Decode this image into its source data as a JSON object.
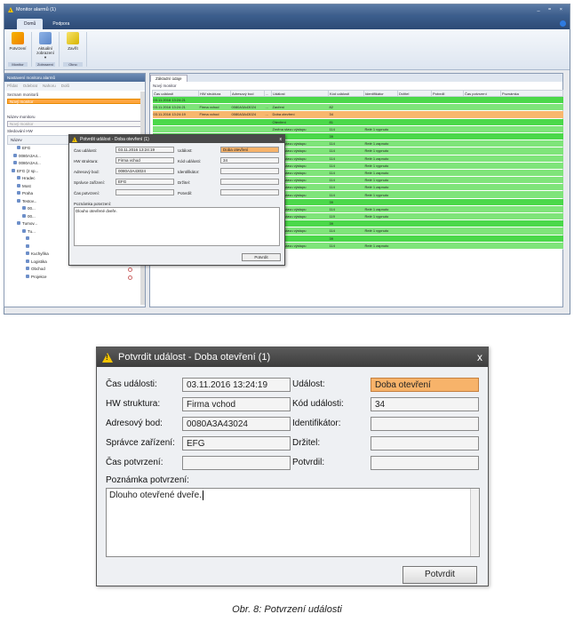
{
  "window": {
    "title": "Monitor alarmů (1)",
    "controls": "_ = ×"
  },
  "ribbon_tabs": [
    "Domů",
    "Podpora"
  ],
  "ribbon": {
    "btn_confirm": "Potvrzení",
    "btn_current": "Aktuální zobrazení ▾",
    "btn_close": "Zavřít",
    "grp1": "Monitor",
    "grp2": "Zobrazení",
    "grp3": "Okno"
  },
  "left_panel": {
    "title": "Nastavení monitoru alarmů",
    "toolbar": [
      "Přidat",
      "Odebrat",
      "Nahoru",
      "Dolů"
    ],
    "list_label": "Seznam monitorů",
    "selected_monitor": "Nový monitor",
    "name_label": "Název monitoru",
    "name_placeholder": "Nový monitor",
    "tracked_label": "Sledování HW",
    "tree_header": "Název",
    "tree": [
      "EFG",
      "0080A3A4...",
      "0080A3A4...",
      "EFG (2 sp...",
      "Hradec",
      "Most",
      "Praha",
      "Testov...",
      "00...",
      "00...",
      "Tumov...",
      "Tu...",
      "",
      "",
      "Kuchyňka",
      "Logistika",
      "Obchod",
      "Projekce"
    ]
  },
  "right_panel": {
    "tab": "Základní údaje",
    "monitor_label": "Nový monitor",
    "columns": [
      "Čas události",
      "HW struktura",
      "Adresový bod",
      "...",
      "Událost",
      "Kód události",
      "Identifikátor",
      "Držitel",
      "Potvrdil",
      "Čas potvrzení",
      "Poznámka"
    ],
    "rows": [
      {
        "c": "r-b",
        "cells": [
          "03.11.2016 13:24:21",
          "",
          "",
          "",
          "",
          "",
          "",
          "",
          "",
          "",
          ""
        ]
      },
      {
        "c": "r-g",
        "cells": [
          "03.11.2016 13:24:21",
          "Firma vchod",
          "0080A3A43024",
          "...",
          "Zavření",
          "82",
          "",
          "",
          "",
          "",
          ""
        ]
      },
      {
        "c": "r-o",
        "cells": [
          "03.11.2016 13:24:19",
          "Firma vchod",
          "0080A3A43024",
          "...",
          "Doba otevření",
          "34",
          "",
          "",
          "",
          "",
          ""
        ]
      },
      {
        "c": "r-b",
        "cells": [
          "",
          "",
          "",
          "",
          "Otevření",
          "81",
          "",
          "",
          "",
          "",
          ""
        ]
      },
      {
        "c": "r-g",
        "cells": [
          "",
          "",
          "",
          "",
          "Změna stavu výstupu",
          "114",
          "Relé 1 vypnuto",
          "",
          "",
          "",
          ""
        ]
      },
      {
        "c": "r-b",
        "cells": [
          "",
          "",
          "",
          "",
          "Tlačítko",
          "39",
          "",
          "",
          "",
          "",
          ""
        ]
      },
      {
        "c": "r-g",
        "cells": [
          "",
          "",
          "",
          "",
          "Změna stavu výstupu",
          "114",
          "Relé 1 zapnuto",
          "",
          "",
          "",
          ""
        ]
      },
      {
        "c": "r-g",
        "cells": [
          "",
          "",
          "",
          "",
          "Změna stavu výstupu",
          "114",
          "Relé 1 vypnuto",
          "",
          "",
          "",
          ""
        ]
      },
      {
        "c": "r-g",
        "cells": [
          "",
          "",
          "",
          "",
          "Změna stavu výstupu",
          "114",
          "Relé 1 zapnuto",
          "",
          "",
          "",
          ""
        ]
      },
      {
        "c": "r-g",
        "cells": [
          "",
          "",
          "",
          "",
          "Změna stavu výstupu",
          "114",
          "Relé 1 vypnuto",
          "",
          "",
          "",
          ""
        ]
      },
      {
        "c": "r-g",
        "cells": [
          "",
          "",
          "",
          "",
          "Změna stavu výstupu",
          "114",
          "Relé 1 zapnuto",
          "",
          "",
          "",
          ""
        ]
      },
      {
        "c": "r-g",
        "cells": [
          "",
          "",
          "",
          "",
          "Změna stavu výstupu",
          "114",
          "Relé 1 vypnuto",
          "",
          "",
          "",
          ""
        ]
      },
      {
        "c": "r-g",
        "cells": [
          "",
          "",
          "",
          "",
          "Změna stavu výstupu",
          "114",
          "Relé 1 zapnuto",
          "",
          "",
          "",
          ""
        ]
      },
      {
        "c": "r-g",
        "cells": [
          "",
          "",
          "",
          "",
          "Změna stavu výstupu",
          "114",
          "Relé 1 vypnuto",
          "",
          "",
          "",
          ""
        ]
      },
      {
        "c": "r-b",
        "cells": [
          "",
          "",
          "",
          "",
          "Tlačítko",
          "39",
          "",
          "",
          "",
          "",
          ""
        ]
      },
      {
        "c": "r-g",
        "cells": [
          "",
          "",
          "",
          "",
          "Změna stavu výstupu",
          "114",
          "Relé 1 zapnuto",
          "",
          "",
          "",
          ""
        ]
      },
      {
        "c": "r-g",
        "cells": [
          "",
          "",
          "",
          "",
          "Změna stavu výstupu",
          "119",
          "Relé 1 vypnuto",
          "",
          "",
          "",
          ""
        ]
      },
      {
        "c": "r-b",
        "cells": [
          "",
          "",
          "",
          "",
          "Tlačítko",
          "39",
          "",
          "",
          "",
          "",
          ""
        ]
      },
      {
        "c": "r-g",
        "cells": [
          "03.11.2016 13:22:38",
          "Firma vchod",
          "0080A3A43024",
          "...",
          "Změna stavu výstupu",
          "114",
          "Relé 1 vypnuto",
          "",
          "",
          "",
          ""
        ]
      },
      {
        "c": "r-b",
        "cells": [
          "03.11.2016 13:22:34",
          "Firma vchod",
          "0080A3A43024",
          "...",
          "Tlačítko",
          "39",
          "",
          "",
          "",
          "",
          ""
        ]
      },
      {
        "c": "r-g",
        "cells": [
          "03.11.2016 13:22:34",
          "Firma vchod",
          "0080A3A43024",
          "...",
          "Změna stavu výstupu",
          "114",
          "Relé 1 zapnuto",
          "",
          "",
          "",
          ""
        ]
      }
    ]
  },
  "dialog": {
    "title": "Potvrdit událost - Doba otevření (1)",
    "close": "x",
    "time_label": "Čas události:",
    "time_value": "03.11.2016 13:24:19",
    "hw_label": "HW struktura:",
    "hw_value": "Firma vchod",
    "addr_label": "Adresový bod:",
    "addr_value": "0080A3A43024",
    "admin_label": "Správce zařízení:",
    "admin_value": "EFG",
    "confirm_time_label": "Čas potvrzení:",
    "confirm_time_value": "",
    "event_label": "Událost:",
    "event_value": "Doba otevření",
    "code_label": "Kód události:",
    "code_value": "34",
    "id_label": "Identifikátor:",
    "id_value": "",
    "holder_label": "Držitel:",
    "holder_value": "",
    "confirmed_label": "Potvrdil:",
    "confirmed_value": "",
    "note_label": "Poznámka potvrzení:",
    "note_value": "Dlouho otevřené dveře.",
    "button": "Potvrdit"
  },
  "caption": "Obr. 8: Potvrzení události"
}
